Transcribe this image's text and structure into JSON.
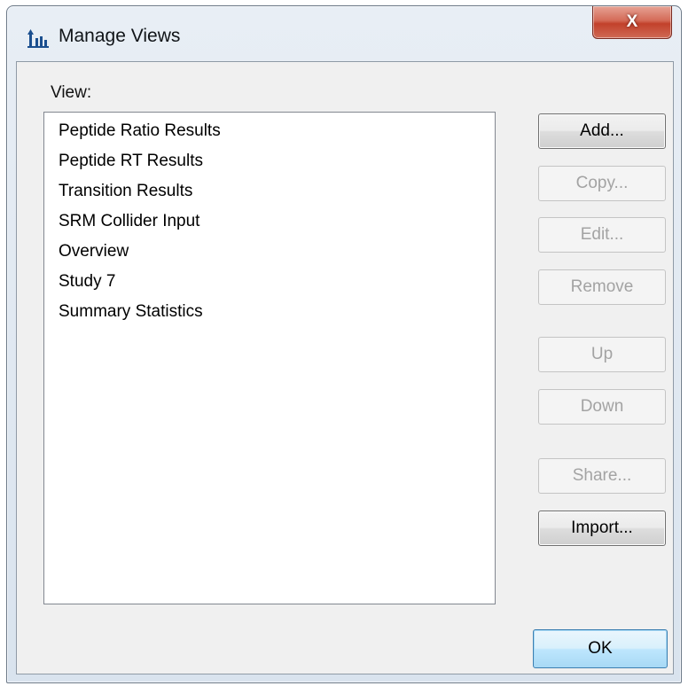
{
  "window": {
    "title": "Manage Views",
    "close_glyph": "X",
    "app_icon": "skyline-chart-icon"
  },
  "view_label": "View:",
  "views": [
    "Peptide Ratio Results",
    "Peptide RT Results",
    "Transition Results",
    "SRM Collider Input",
    "Overview",
    "Study 7",
    "Summary Statistics"
  ],
  "buttons": {
    "add": "Add...",
    "copy": "Copy...",
    "edit": "Edit...",
    "remove": "Remove",
    "up": "Up",
    "down": "Down",
    "share": "Share...",
    "import": "Import...",
    "ok": "OK"
  },
  "colors": {
    "close_button": "#c84a35",
    "icon_blue": "#1b4f8f",
    "disabled_text": "#a3a3a3"
  }
}
